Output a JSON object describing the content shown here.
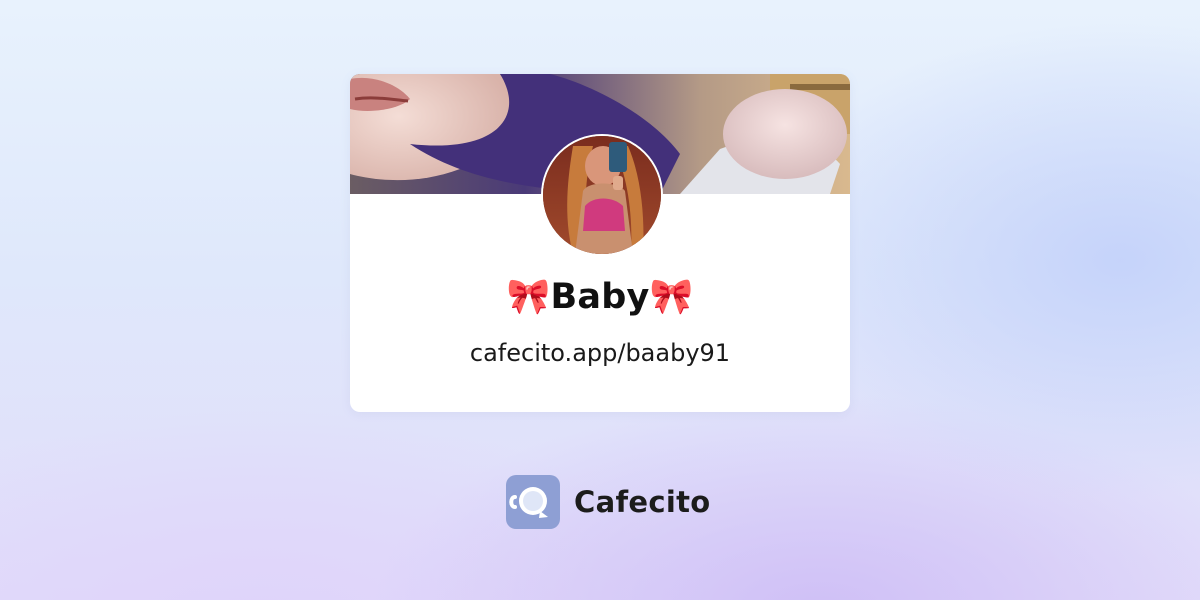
{
  "profile": {
    "display_name": "🎀Baby🎀",
    "page_url": "cafecito.app/baaby91",
    "cover_image": "cover-photo",
    "avatar_image": "profile-photo"
  },
  "brand": {
    "name": "Cafecito",
    "logo_icon": "cafecito-cup-icon",
    "logo_color": "#8e9fd4"
  },
  "colors": {
    "card_background": "#ffffff",
    "text": "#111111"
  }
}
